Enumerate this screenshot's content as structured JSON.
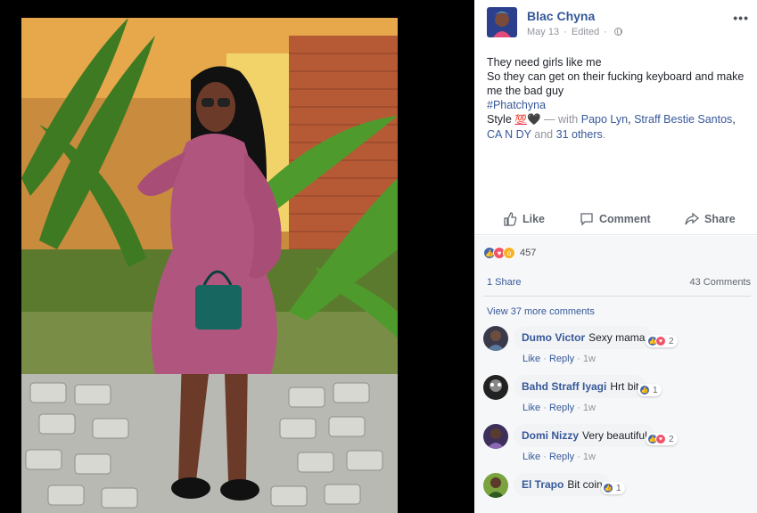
{
  "post": {
    "author": "Blac Chyna",
    "date": "May 13",
    "edited": "Edited",
    "separator": "·",
    "more": "•••",
    "text_lines": [
      "They need girls like me",
      "So they can get on their fucking keyboard and make me the bad guy"
    ],
    "hashtag": "#Phatchyna",
    "style_text": "Style",
    "emoji_100": "💯",
    "emoji_heart": "🖤",
    "with_text": "— with",
    "tag1": "Papo Lyn",
    "comma": ",",
    "tag2": "Straff Bestie Santos",
    "tag3": "CA N DY",
    "and_text": "and",
    "others": "31 others",
    "period": "."
  },
  "actions": {
    "like": "Like",
    "comment": "Comment",
    "share": "Share"
  },
  "feedback": {
    "reaction_count": "457",
    "shares": "1 Share",
    "comments": "43 Comments",
    "view_more": "View 37 more comments"
  },
  "comments": [
    {
      "name": "Dumo Victor",
      "text": "Sexy mama",
      "reaction_count": "2",
      "reactions": [
        "like",
        "love"
      ],
      "like": "Like",
      "reply": "Reply",
      "time": "1w",
      "dot": "·"
    },
    {
      "name": "Bahd Straff Iyagi",
      "text": "Hrt bit",
      "reaction_count": "1",
      "reactions": [
        "like"
      ],
      "like": "Like",
      "reply": "Reply",
      "time": "1w",
      "dot": "·"
    },
    {
      "name": "Domi Nizzy",
      "text": "Very beautiful",
      "reaction_count": "2",
      "reactions": [
        "like",
        "love"
      ],
      "like": "Like",
      "reply": "Reply",
      "time": "1w",
      "dot": "·"
    },
    {
      "name": "El Trapo",
      "text": "Bit coin",
      "reaction_count": "1",
      "reactions": [
        "like"
      ]
    }
  ],
  "colors": {
    "link": "#365899",
    "muted": "#90949c",
    "like_blue": "#4267b2",
    "love_red": "#f25268",
    "wow_yellow": "#f7b125"
  }
}
